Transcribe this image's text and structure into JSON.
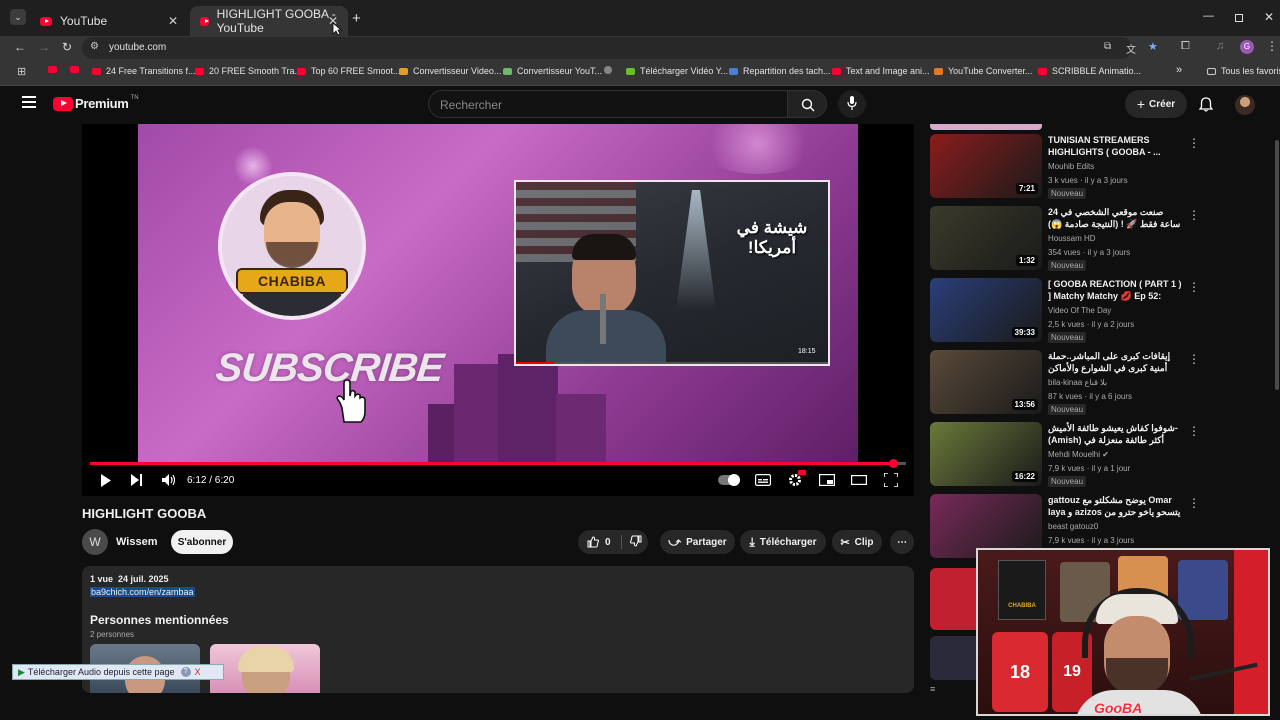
{
  "browser": {
    "tabs": [
      {
        "title": "YouTube",
        "active": false
      },
      {
        "title": "HIGHLIGHT GOOBA - YouTube",
        "active": true
      }
    ],
    "url": "youtube.com",
    "bookmarks": [
      "24 Free Transitions f...",
      "20 FREE Smooth Tra...",
      "Top 60 FREE Smoot...",
      "Convertisseur Video...",
      "Convertisseur YouT...",
      "Télécharger Vidéo Y...",
      "Repartition des tach...",
      "Text and Image ani...",
      "YouTube Converter...",
      "SCRIBBLE Animatio..."
    ],
    "bookmarks_more": "»",
    "all_bookmarks": "Tous les favoris"
  },
  "yt": {
    "logo": "Premium",
    "logo_sup": "TN",
    "search_placeholder": "Rechercher",
    "create_label": "Créer"
  },
  "player": {
    "thumb_name": "CHABIBA",
    "subscribe_text": "SUBSCRIBE",
    "inner_title": "شيشة في أمريكا!",
    "inner_time": "18:15",
    "progress": 0.984,
    "time_display": "6:12 / 6:20"
  },
  "video": {
    "title": "HIGHLIGHT GOOBA",
    "channel_initial": "W",
    "channel": "Wissem",
    "subscribe": "S'abonner",
    "likes": "0",
    "share": "Partager",
    "download": "Télécharger",
    "clip": "Clip",
    "more": "⋯",
    "views_date": "1 vue  24 juil. 2025",
    "link": "ba9chich.com/en/zambaa",
    "mentioned_title": "Personnes mentionnées",
    "mentioned_count": "2 personnes"
  },
  "recommendations": [
    {
      "title": "TUNISIAN STREAMERS HIGHLIGHTS ( GOOBA - ...",
      "channel": "Mouhib Edits",
      "meta": "3 k vues · il y a 3 jours",
      "badge": "Nouveau",
      "duration": "7:21",
      "color": "#8b1c1c"
    },
    {
      "title": "صنعت موقعي الشخصي في 24 ساعة فقط 🚀 ! (النتيجة صادمة 😱)",
      "channel": "Houssam HD",
      "meta": "354 vues · il y a 3 jours",
      "badge": "Nouveau",
      "duration": "1:32",
      "color": "#3a3a2a"
    },
    {
      "title": "[ GOOBA REACTION ( PART 1 ) ] Matchy Matchy 💋 Ep 52: Cha...",
      "channel": "Video Of The Day",
      "meta": "2,5 k vues · il y a 2 jours",
      "badge": "Nouveau",
      "duration": "39:33",
      "color": "#2a3f7a"
    },
    {
      "title": "إيقافات كبرى على المباشر..حملة أمنية كبرى في الشوارع والأماكن العامة لمكافحة الشغل",
      "channel": "bila-kinaa بلا قناع",
      "meta": "87 k vues · il y a 6 jours",
      "badge": "Nouveau",
      "duration": "13:56",
      "color": "#5a4a3a"
    },
    {
      "title": "شوفوا كفاش يعيشو طائفة الأميش- (Amish) أكثر طائفة منعزلة في العالم ...",
      "channel": "Mehdi Mouelhi ✔",
      "meta": "7,9 k vues · il y a 1 jour",
      "badge": "Nouveau",
      "duration": "16:22",
      "color": "#6a7a3a"
    },
    {
      "title": "gattouz يوضح مشكلتو مع Omar laya و azizos يتسحو ياخو حترو من مرتو",
      "channel": "beast gatouz0",
      "meta": "7,9 k vues · il y a 3 jours",
      "badge": "",
      "duration": "",
      "color": "#7a2a5a"
    }
  ],
  "ext_bar": {
    "label": "Télécharger Audio depuis cette page",
    "help": "?",
    "close": "X"
  },
  "cam": {
    "watermark": "GooBA",
    "poster_text": "CHABIBA",
    "jersey_a": "18",
    "jersey_b": "19"
  }
}
